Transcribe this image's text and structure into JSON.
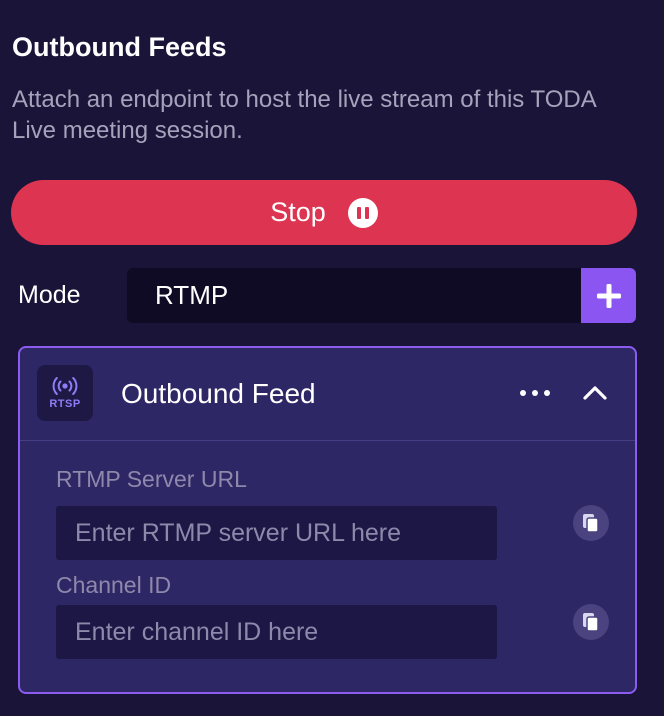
{
  "panel": {
    "title": "Outbound Feeds",
    "description": "Attach an endpoint to host the live stream of this TODA Live meeting session.",
    "stop_button_label": "Stop"
  },
  "mode": {
    "label": "Mode",
    "selected_value": "RTMP"
  },
  "feed": {
    "badge_label": "RTSP",
    "title": "Outbound Feed",
    "fields": [
      {
        "label": "RTMP Server URL",
        "placeholder": "Enter RTMP server URL here",
        "value": ""
      },
      {
        "label": "Channel ID",
        "placeholder": "Enter channel ID here",
        "value": ""
      }
    ]
  },
  "icons": {
    "stop_button": "pause-circle-icon",
    "add_button": "plus-icon",
    "badge": "broadcast-icon",
    "more": "ellipsis-icon",
    "collapse": "chevron-up-icon",
    "copy": "copy-icon"
  },
  "colors": {
    "background": "#1a1438",
    "stop_button": "#dd3451",
    "accent": "#8a55f0",
    "card_background": "#2e2766",
    "card_border": "#8a5cf0",
    "input_background": "#1c1745"
  }
}
